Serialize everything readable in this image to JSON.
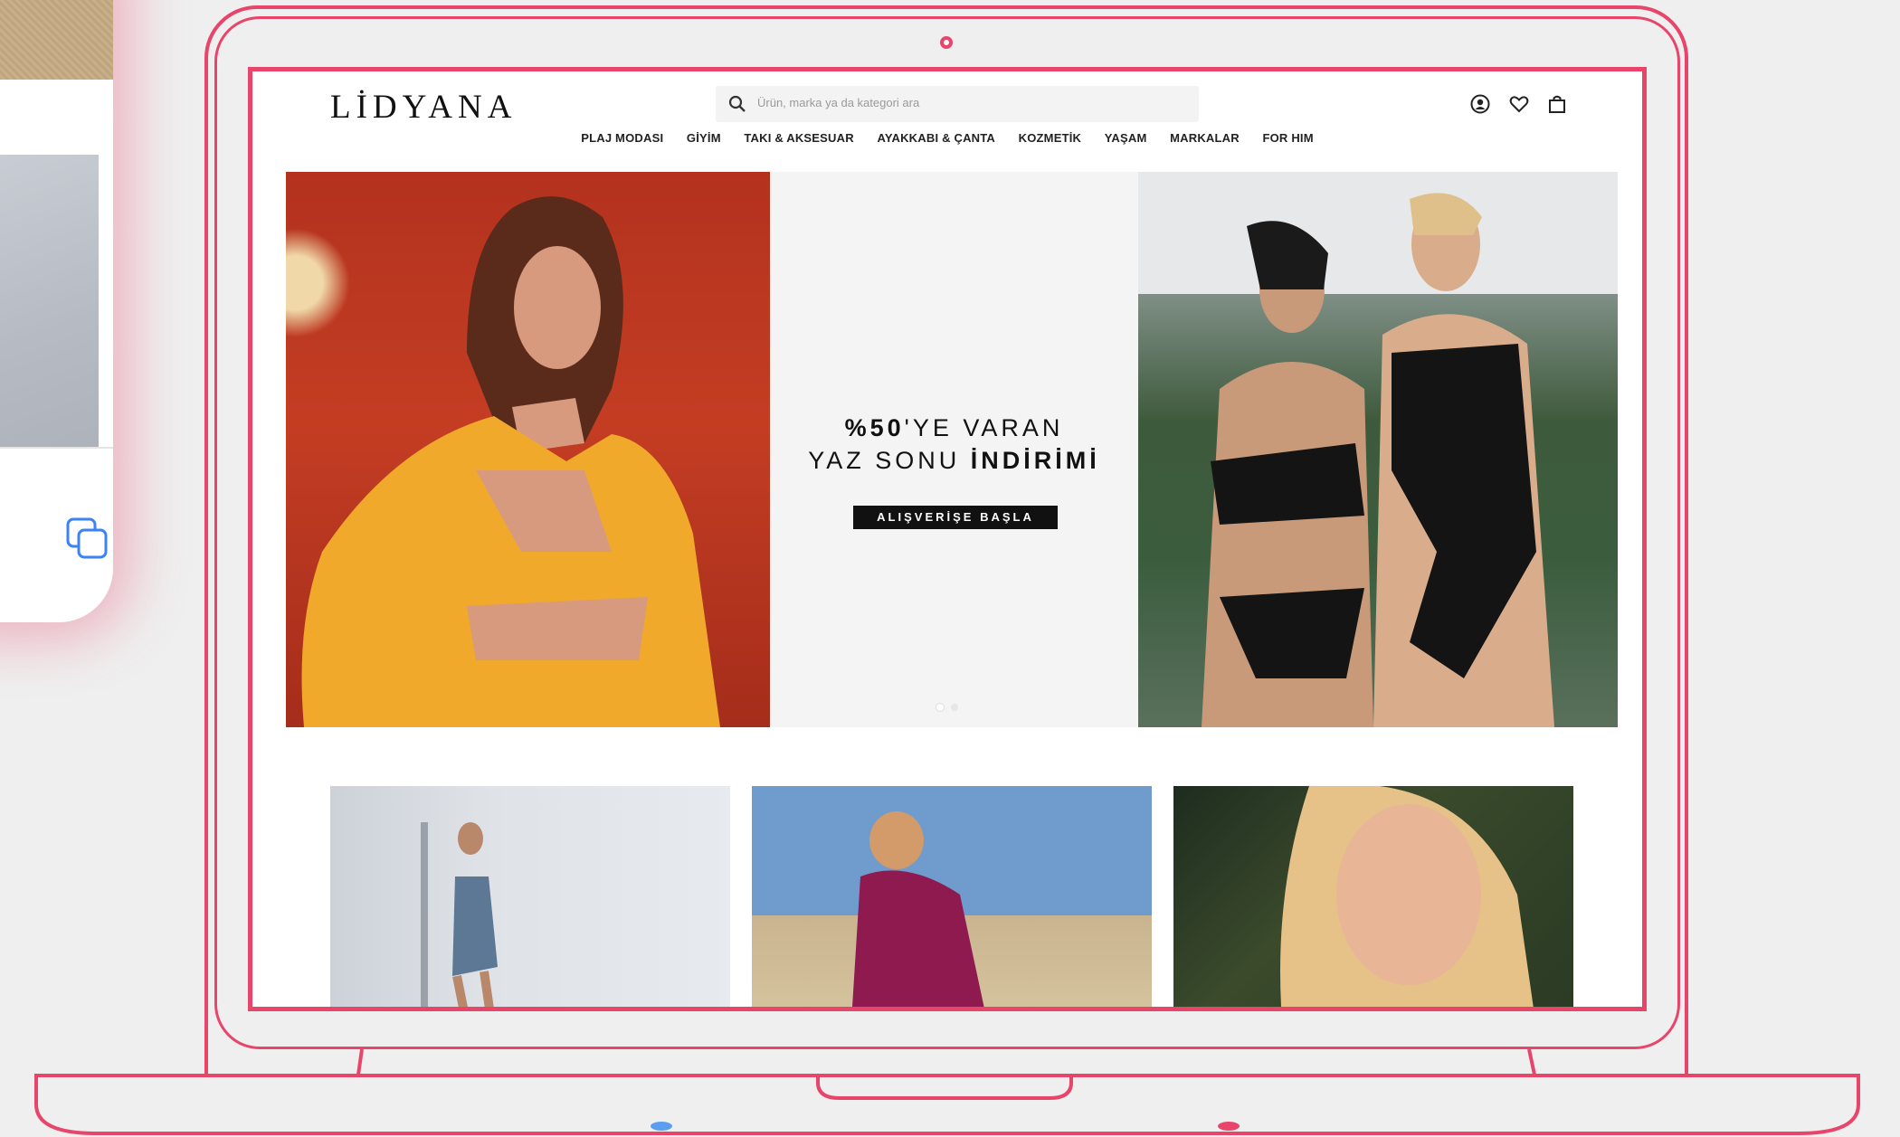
{
  "site": {
    "logo": "LİDYANA",
    "search_placeholder": "Ürün, marka ya da kategori ara",
    "nav": [
      "PLAJ MODASI",
      "GİYİM",
      "TAKI & AKSESUAR",
      "AYAKKABI & ÇANTA",
      "KOZMETİK",
      "YAŞAM",
      "MARKALAR",
      "FOR HIM"
    ],
    "header_icons": [
      "user-icon",
      "heart-icon",
      "bag-icon"
    ]
  },
  "hero": {
    "promo_prefix": "%50",
    "promo_line1_rest": "'YE VARAN",
    "promo_line2_start": "YAZ SONU ",
    "promo_line2_bold": "İNDİRİMİ",
    "cta": "ALIŞVERİŞE BAŞLA",
    "slides": 2,
    "active_slide": 1
  },
  "colors": {
    "frame": "#e8456a",
    "accent_blue": "#3b82f6"
  }
}
